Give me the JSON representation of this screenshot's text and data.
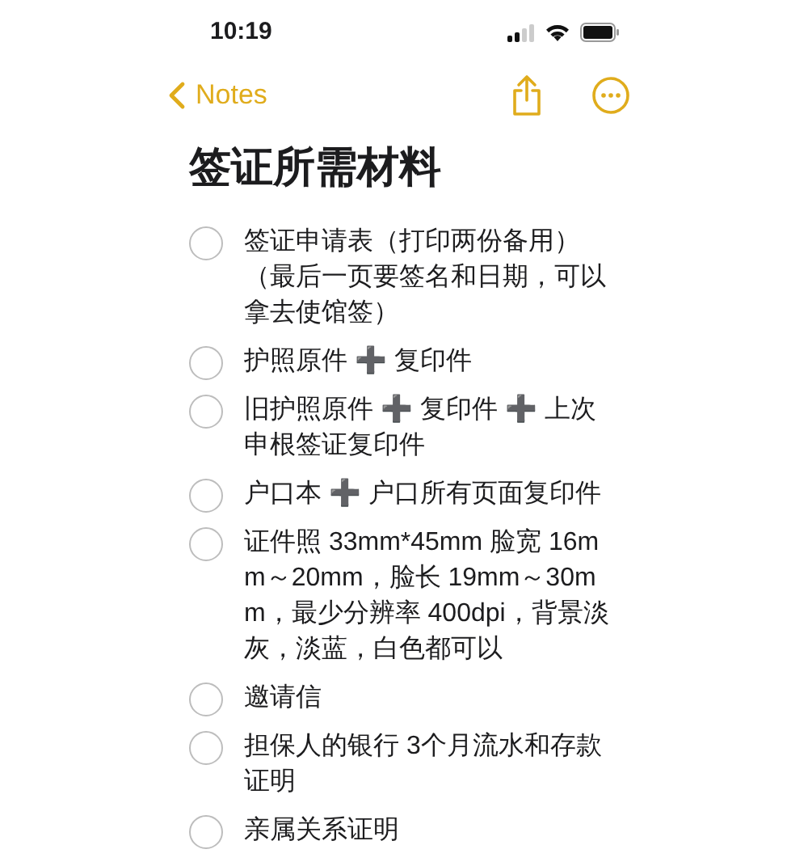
{
  "status_bar": {
    "time": "10:19"
  },
  "nav": {
    "back": "Notes"
  },
  "note": {
    "title": "签证所需材料",
    "items": [
      {
        "text": "签证申请表（打印两份备用）（最后一页要签名和日期，可以拿去使馆签）",
        "checked": false
      },
      {
        "text": "护照原件 ➕ 复印件",
        "checked": false
      },
      {
        "text": "旧护照原件 ➕ 复印件 ➕ 上次申根签证复印件",
        "checked": false
      },
      {
        "text": "户口本 ➕ 户口所有页面复印件",
        "checked": false
      },
      {
        "text": "证件照 33mm*45mm 脸宽 16mm～20mm，脸长 19mm～30mm，最少分辨率 400dpi，背景淡灰，淡蓝，白色都可以",
        "checked": false
      },
      {
        "text": "邀请信",
        "checked": false
      },
      {
        "text": "担保人的银行 3个月流水和存款证明",
        "checked": false
      },
      {
        "text": "亲属关系证明",
        "checked": false
      }
    ]
  }
}
